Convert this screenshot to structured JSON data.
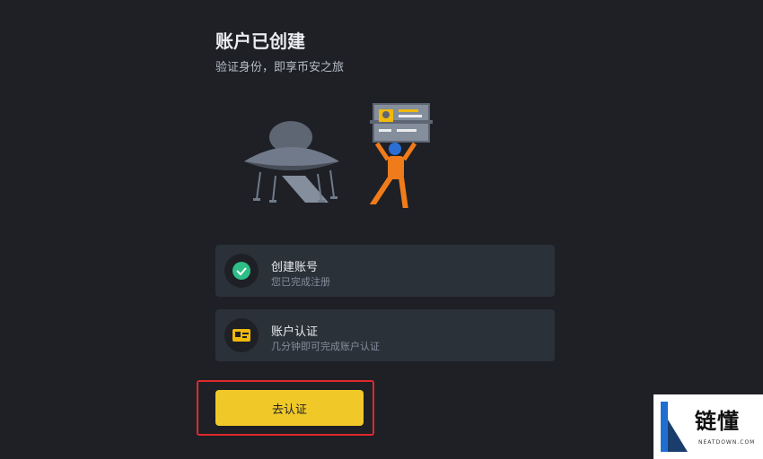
{
  "header": {
    "title": "账户已创建",
    "subtitle": "验证身份，即享币安之旅"
  },
  "illustration": {
    "icon": "spaceship-astronaut-id-card-illustration"
  },
  "steps": [
    {
      "title": "创建账号",
      "description": "您已完成注册",
      "icon": "check-circle-icon",
      "status_color": "#2ebd85"
    },
    {
      "title": "账户认证",
      "description": "几分钟即可完成账户认证",
      "icon": "id-card-icon",
      "status_color": "#f0b90b"
    }
  ],
  "cta": {
    "label": "去认证",
    "color": "#f0c929",
    "highlight_color": "#e0282c"
  },
  "watermark": {
    "text": "链懂",
    "sub": "NEATDOWN.COM"
  }
}
